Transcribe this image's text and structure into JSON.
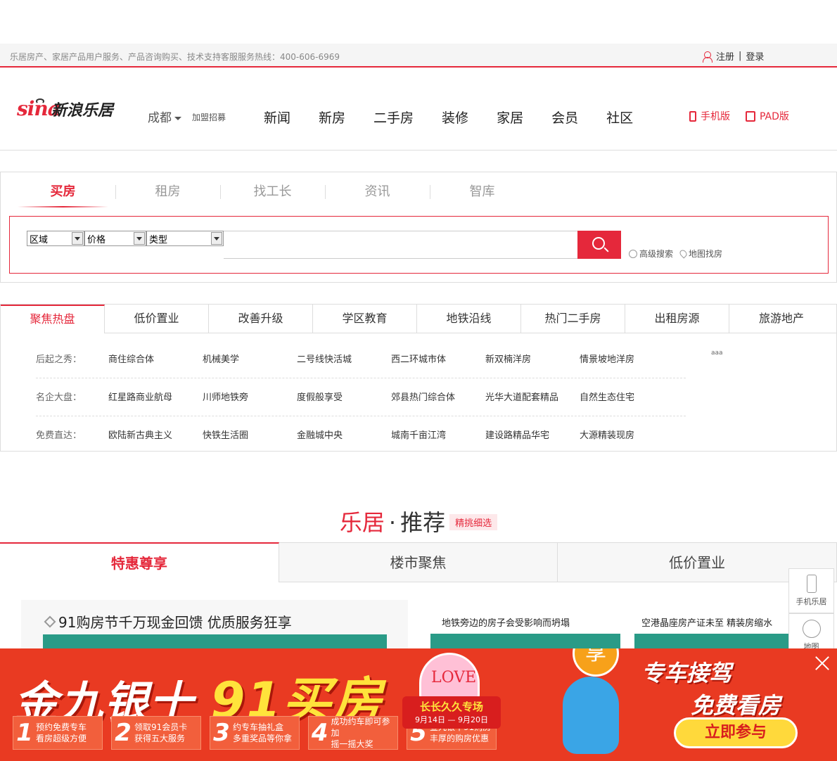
{
  "topbar": {
    "hotline": "乐居房产、家居产品用户服务、产品咨询购买、技术支持客服服务热线：400-606-6969",
    "register": "注册",
    "separator": "|",
    "login": "登录"
  },
  "header": {
    "logo_sina": "sina",
    "logo_brand": "新浪乐居",
    "city": "成都",
    "join": "加盟招募",
    "nav": [
      "新闻",
      "新房",
      "二手房",
      "装修",
      "家居",
      "会员",
      "社区"
    ],
    "mobile": "手机版",
    "pad": "PAD版"
  },
  "search": {
    "tabs": [
      "买房",
      "租房",
      "找工长",
      "资讯",
      "智库"
    ],
    "selects": [
      "区域",
      "价格",
      "类型"
    ],
    "placeholder": "",
    "advanced": "高级搜索",
    "map": "地图找房"
  },
  "hot": {
    "tabs": [
      "聚焦热盘",
      "低价置业",
      "改善升级",
      "学区教育",
      "地铁沿线",
      "热门二手房",
      "出租房源",
      "旅游地产"
    ],
    "rows": [
      {
        "label": "后起之秀：",
        "items": [
          "商住综合体",
          "机械美学",
          "二号线快活城",
          "西二环城市体",
          "新双楠洋房",
          "情景坡地洋房"
        ]
      },
      {
        "label": "名企大盘：",
        "items": [
          "红星路商业航母",
          "川师地铁旁",
          "度假般享受",
          "郊县热门综合体",
          "光华大道配套精品",
          "自然生态住宅"
        ]
      },
      {
        "label": "免费直达：",
        "items": [
          "欧陆新古典主义",
          "快铁生活圈",
          "金融城中央",
          "城南千亩江湾",
          "建设路精品华宅",
          "大源精装现房"
        ]
      }
    ],
    "aside": "aaa"
  },
  "recommend": {
    "title1": "乐居",
    "dot": "·",
    "title2": "推荐",
    "tag": "精挑细选",
    "tabs": [
      "特惠尊享",
      "楼市聚焦",
      "低价置业"
    ],
    "card_title": "91购房节千万现金回馈 优质服务狂享",
    "caption_left": "地铁旁边的房子会受影响而坍塌",
    "caption_right": "空港晶座房产证未至 精装房缩水"
  },
  "sidetools": {
    "mobile": "手机乐居",
    "map": "地图"
  },
  "promo": {
    "headline_a": "金九银十",
    "headline_b": "91买房",
    "love": "LOVE",
    "ribbon_title": "长长久久专场",
    "ribbon_date": "9月14日 — 9月20日",
    "mascot_char": "享",
    "right_line1": "专车接驾",
    "right_line2": "免费看房",
    "cta": "立即参与",
    "steps": [
      {
        "n": "1",
        "l1": "预约免费专车",
        "l2": "看房超级方便"
      },
      {
        "n": "2",
        "l1": "领取91会员卡",
        "l2": "获得五大服务"
      },
      {
        "n": "3",
        "l1": "约专车抽礼盒",
        "l2": "多重奖品等你拿"
      },
      {
        "n": "4",
        "l1": "成功约车即可参加",
        "l2": "摇一摇大奖"
      },
      {
        "n": "5",
        "l1": "金九银十91购房",
        "l2": "丰厚的购房优惠"
      }
    ]
  },
  "colors": {
    "accent": "#e5283b",
    "promo_bg": "#e93a22",
    "promo_yellow": "#ffe33b"
  }
}
